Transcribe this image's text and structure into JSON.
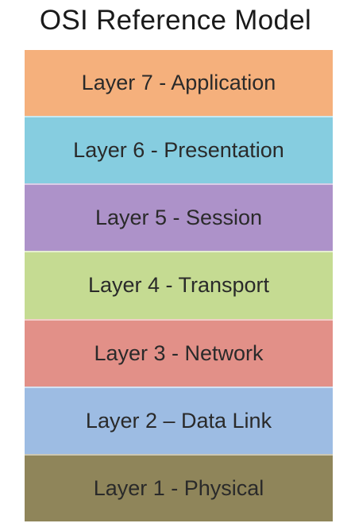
{
  "title": "OSI Reference Model",
  "layers": [
    {
      "label": "Layer 7 - Application",
      "color": "#f5b07c"
    },
    {
      "label": "Layer 6 - Presentation",
      "color": "#86cde0"
    },
    {
      "label": "Layer 5 - Session",
      "color": "#ad92c9"
    },
    {
      "label": "Layer 4 - Transport",
      "color": "#c5db92"
    },
    {
      "label": "Layer 3 - Network",
      "color": "#e29088"
    },
    {
      "label": "Layer 2 – Data Link",
      "color": "#9dbce3"
    },
    {
      "label": "Layer 1 - Physical",
      "color": "#8f855a"
    }
  ]
}
